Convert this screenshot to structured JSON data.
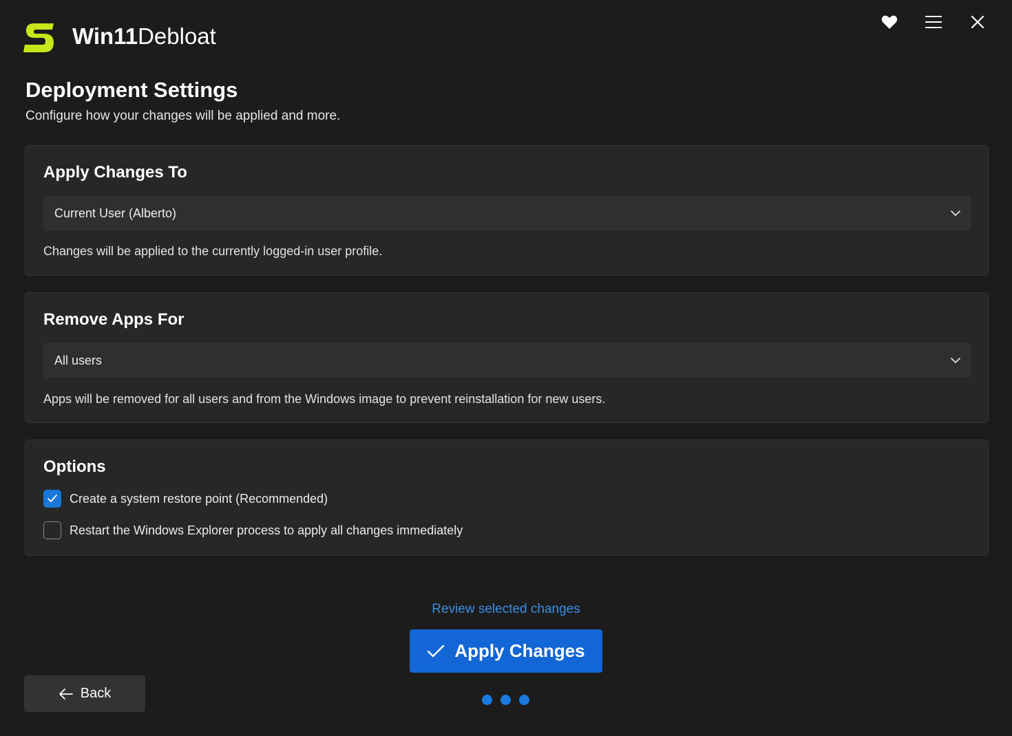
{
  "header": {
    "app_name_bold": "Win11",
    "app_name_regular": "Debloat",
    "logo_color": "#c8e61a",
    "actions": [
      {
        "icon": "heart-icon"
      },
      {
        "icon": "menu-icon"
      },
      {
        "icon": "close-icon"
      }
    ]
  },
  "page": {
    "title": "Deployment Settings",
    "subtitle": "Configure how your changes will be applied and more."
  },
  "apply_changes_to": {
    "title": "Apply Changes To",
    "selected": "Current User (Alberto)",
    "description": "Changes will be applied to the currently logged-in user profile."
  },
  "remove_apps_for": {
    "title": "Remove Apps For",
    "selected": "All users",
    "description": "Apps will be removed for all users and from the Windows image to prevent reinstallation for new users."
  },
  "options": {
    "title": "Options",
    "items": [
      {
        "label": "Create a system restore point (Recommended)",
        "checked": true
      },
      {
        "label": "Restart the Windows Explorer process to apply all changes immediately",
        "checked": false
      }
    ]
  },
  "footer": {
    "review_link": "Review selected changes",
    "apply_label": "Apply Changes",
    "back_label": "Back",
    "page_dots": 3,
    "accent_color": "#1266d6"
  }
}
